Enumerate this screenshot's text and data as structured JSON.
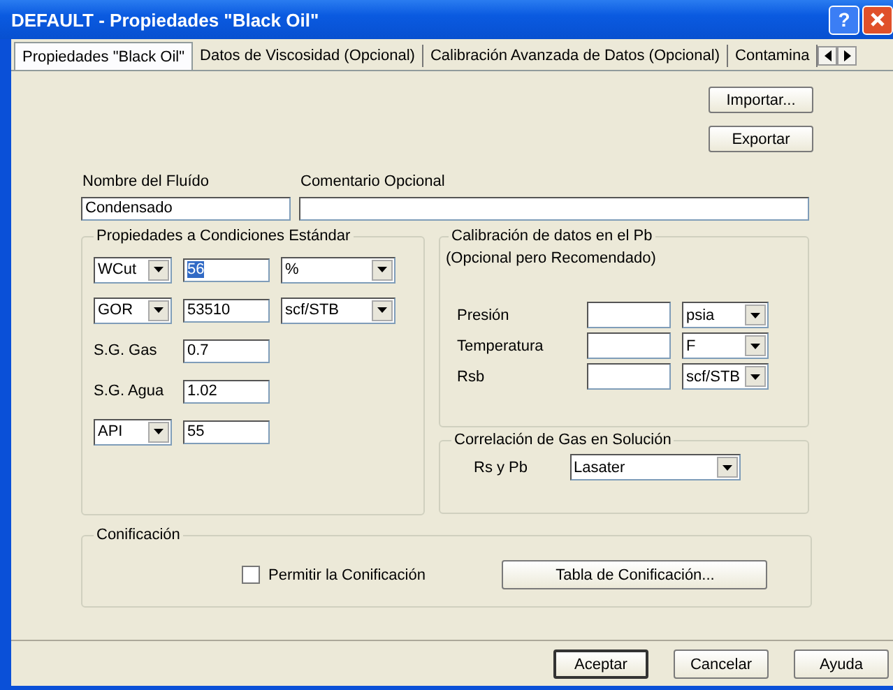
{
  "window": {
    "title": "DEFAULT - Propiedades \"Black Oil\"",
    "help": "?"
  },
  "tabs": [
    {
      "label": "Propiedades \"Black Oil\"",
      "selected": true
    },
    {
      "label": "Datos de Viscosidad (Opcional)",
      "selected": false
    },
    {
      "label": "Calibración Avanzada de Datos (Opcional)",
      "selected": false
    },
    {
      "label": "Contamina",
      "selected": false
    }
  ],
  "top_buttons": [
    "Importar...",
    "Exportar"
  ],
  "fluid_name": {
    "label": "Nombre del Fluído",
    "value": "Condensado"
  },
  "comment": {
    "label": "Comentario Opcional"
  },
  "standard_conditions": {
    "title": "Propiedades a Condiciones Estándar",
    "rows": [
      {
        "kind": "combo",
        "name": "WCut",
        "value": "56",
        "selected": true,
        "unit": "%"
      },
      {
        "kind": "combo",
        "name": "GOR",
        "value": "53510",
        "selected": false,
        "unit": "scf/STB"
      },
      {
        "kind": "label",
        "name": "S.G. Gas",
        "value": "0.7",
        "selected": false
      },
      {
        "kind": "label",
        "name": "S.G. Agua",
        "value": "1.02",
        "selected": false
      },
      {
        "kind": "combo",
        "name": "API",
        "value": "55",
        "selected": false
      }
    ]
  },
  "calibration": {
    "title": "Calibración de datos en el Pb",
    "subtitle": "(Opcional pero Recomendado)",
    "rows": [
      {
        "label": "Presión",
        "unit": "psia"
      },
      {
        "label": "Temperatura",
        "unit": "F"
      },
      {
        "label": "Rsb",
        "unit": "scf/STB"
      }
    ]
  },
  "correlation": {
    "title": "Correlación de Gas en Solución",
    "label": "Rs y Pb",
    "value": "Lasater"
  },
  "conification": {
    "title": "Conificación",
    "checkbox": {
      "label": "Permitir la Conificación",
      "checked": false
    },
    "button": "Tabla de Conificación..."
  },
  "footer_buttons": [
    {
      "label": "Aceptar",
      "default": true
    },
    {
      "label": "Cancelar",
      "default": false
    },
    {
      "label": "Ayuda",
      "default": false
    }
  ]
}
